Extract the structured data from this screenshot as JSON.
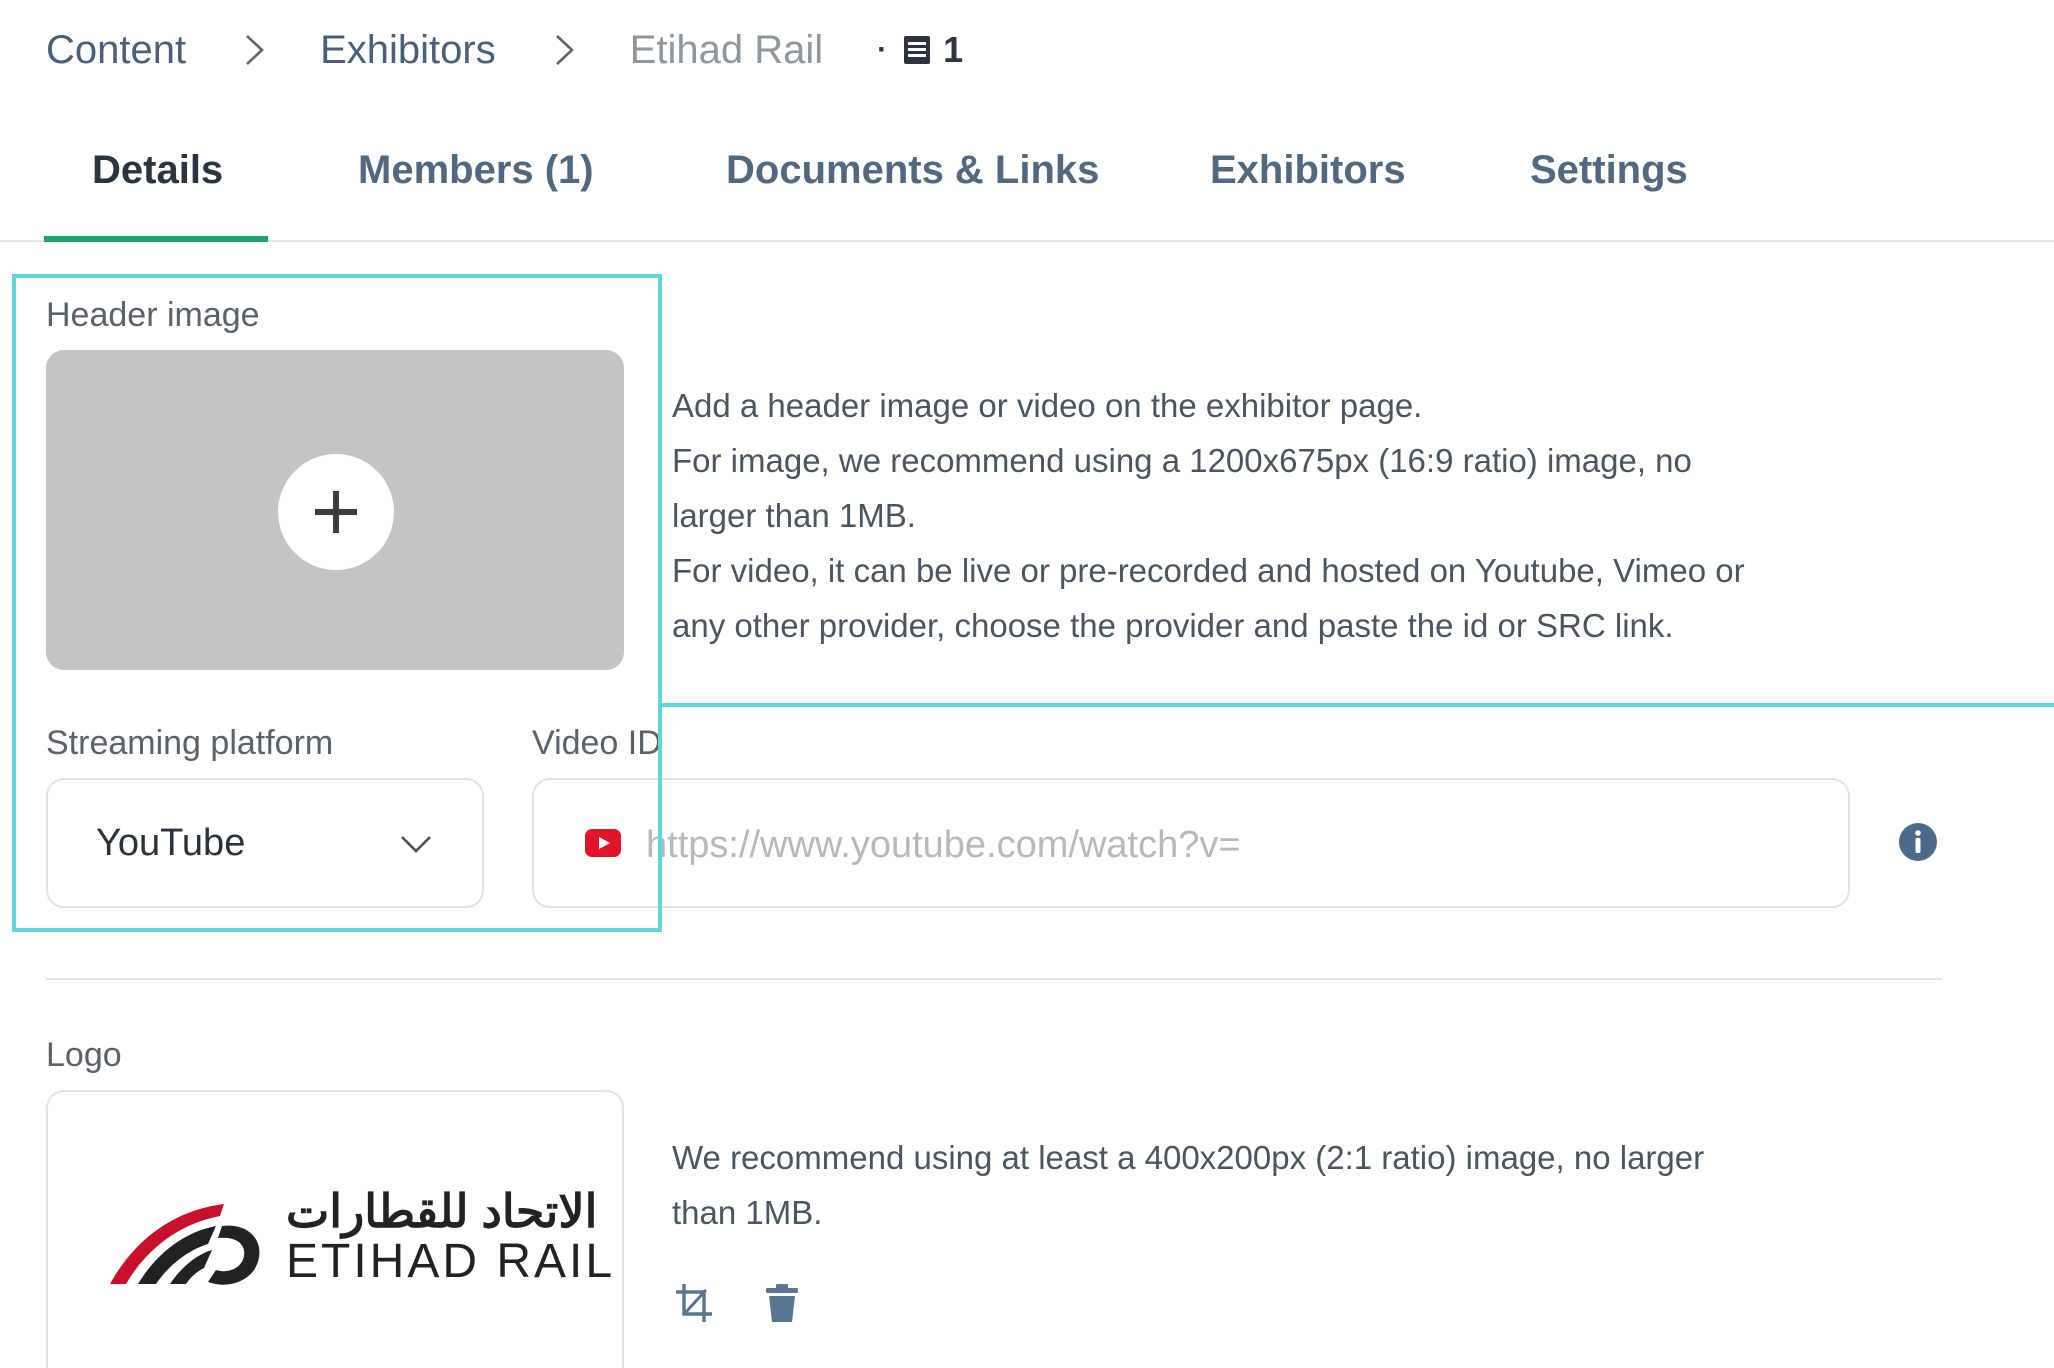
{
  "breadcrumb": {
    "items": [
      "Content",
      "Exhibitors"
    ],
    "current": "Etihad Rail",
    "meta_dot": "·",
    "meta_count": "1"
  },
  "tabs": [
    {
      "label": "Details",
      "active": true
    },
    {
      "label": "Members (1)"
    },
    {
      "label": "Documents & Links"
    },
    {
      "label": "Exhibitors"
    },
    {
      "label": "Settings"
    }
  ],
  "header_image": {
    "label": "Header image",
    "help_lines": [
      "Add a header image or video on the exhibitor page.",
      "For image, we recommend using a 1200x675px (16:9 ratio) image, no",
      "larger than 1MB.",
      "For video, it can be live or pre-recorded and hosted on Youtube, Vimeo or",
      "any other provider, choose the provider and paste the id or SRC link."
    ]
  },
  "streaming": {
    "label": "Streaming platform",
    "selected": "YouTube"
  },
  "video": {
    "label": "Video ID",
    "value": "",
    "placeholder": "https://www.youtube.com/watch?v="
  },
  "logo": {
    "label": "Logo",
    "image_text_arabic": "الاتحاد للقطارات",
    "image_text_latin": "ETIHAD RAIL",
    "help_lines": [
      "We recommend using at least a 400x200px (2:1 ratio) image, no larger",
      "than 1MB."
    ]
  },
  "colors": {
    "accent": "#19a46b",
    "highlight": "#5fd6dd",
    "youtube": "#e0142a",
    "info": "#4c6b8a"
  }
}
